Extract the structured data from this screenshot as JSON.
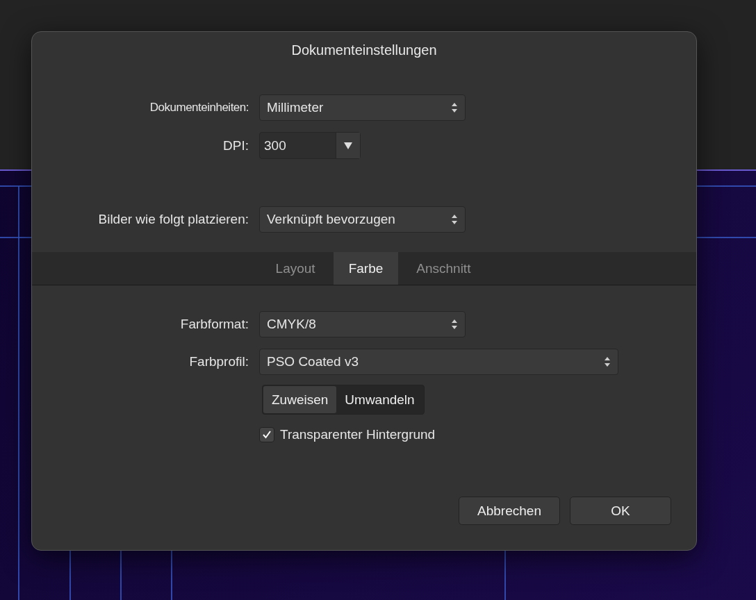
{
  "dialog": {
    "title": "Dokumenteinstellungen",
    "general_fields": [
      {
        "kind": "select",
        "label": "Dokumenteinheiten:",
        "value": "Millimeter"
      },
      {
        "kind": "combo",
        "label": "DPI:",
        "value": "300"
      },
      {
        "kind": "select",
        "label": "Bilder wie folgt platzieren:",
        "value": "Verknüpft bevorzugen"
      }
    ],
    "tabs": [
      {
        "label": "Layout",
        "selected": false
      },
      {
        "label": "Farbe",
        "selected": true
      },
      {
        "label": "Anschnitt",
        "selected": false
      }
    ],
    "color_fields": [
      {
        "kind": "select",
        "label": "Farbformat:",
        "value": "CMYK/8"
      },
      {
        "kind": "wide-select",
        "label": "Farbprofil:",
        "value": "PSO Coated v3"
      }
    ],
    "profile_action": [
      {
        "label": "Zuweisen",
        "selected": true
      },
      {
        "label": "Umwandeln",
        "selected": false
      }
    ],
    "transparent_background": {
      "label": "Transparenter Hintergrund",
      "checked": true
    },
    "buttons": [
      "Abbrechen",
      "OK"
    ]
  }
}
